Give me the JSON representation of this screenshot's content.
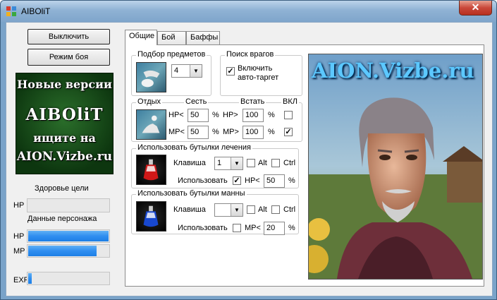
{
  "window": {
    "title": "AIBOliT",
    "close_glyph": "✕"
  },
  "left": {
    "off_button": "Выключить",
    "combat_button": "Режим боя",
    "banner": {
      "line1": "Новые версии",
      "line2": "AIBOliT",
      "line3": "ищите на",
      "line4": "AION.Vizbe.ru"
    },
    "target_health_label": "Здоровье цели",
    "target_hp_label": "HP",
    "target_hp_fill": 0,
    "char_data_label": "Данные персонажа",
    "hp_label": "HP",
    "hp_fill": 1.0,
    "mp_label": "MP",
    "mp_fill": 0.85,
    "exp_label": "EXP",
    "exp_fill": 0.06
  },
  "tabs": [
    {
      "label": "Общие",
      "active": true
    },
    {
      "label": "Бой",
      "active": false
    },
    {
      "label": "Баффы",
      "active": false
    }
  ],
  "loot": {
    "title": "Подбор предметов",
    "value": "4"
  },
  "enemy": {
    "title": "Поиск врагов",
    "checkbox_label_1": "Включить",
    "checkbox_label_2": "авто-таргет",
    "checked": true
  },
  "rest": {
    "title": "Отдых",
    "col_sit": "Сесть",
    "col_stand": "Встать",
    "col_on": "ВКЛ",
    "hp_sit_label": "HP<",
    "hp_sit_value": "50",
    "hp_stand_label": "HP>",
    "hp_stand_value": "100",
    "mp_sit_label": "MP<",
    "mp_sit_value": "50",
    "mp_stand_label": "MP>",
    "mp_stand_value": "100",
    "percent": "%",
    "hp_enabled": false,
    "mp_enabled": true
  },
  "heal_potion": {
    "title": "Использовать бутылки лечения",
    "key_label": "Клавиша",
    "key_value": "1",
    "alt_label": "Alt",
    "ctrl_label": "Ctrl",
    "use_label": "Использовать",
    "use_checked": true,
    "threshold_label": "HP<",
    "threshold_value": "50",
    "percent": "%"
  },
  "mana_potion": {
    "title": "Использовать бутылки манны",
    "key_label": "Клавиша",
    "key_value": "",
    "alt_label": "Alt",
    "ctrl_label": "Ctrl",
    "use_label": "Использовать",
    "use_checked": false,
    "threshold_label": "MP<",
    "threshold_value": "20",
    "percent": "%"
  },
  "art": {
    "caption": "AION.Vizbe.ru"
  },
  "colors": {
    "bar_blue": "#2f8ef0",
    "banner_green": "#1c5a1e",
    "art_caption": "#5cc8ff"
  }
}
